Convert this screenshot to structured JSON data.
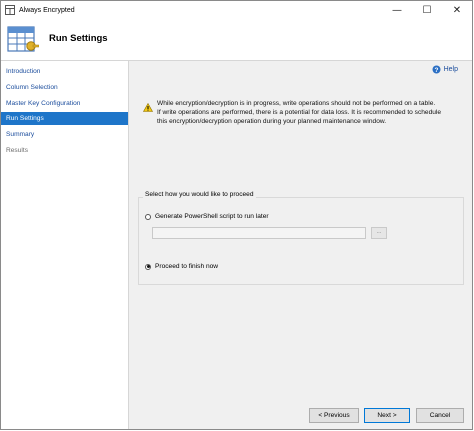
{
  "window": {
    "title": "Always Encrypted",
    "controls": {
      "minimize": "—",
      "maximize": "☐",
      "close": "✕"
    }
  },
  "header": {
    "title": "Run Settings"
  },
  "sidebar": {
    "items": [
      {
        "label": "Introduction",
        "state": "link"
      },
      {
        "label": "Column Selection",
        "state": "link"
      },
      {
        "label": "Master Key Configuration",
        "state": "link"
      },
      {
        "label": "Run Settings",
        "state": "selected"
      },
      {
        "label": "Summary",
        "state": "link"
      },
      {
        "label": "Results",
        "state": "disabled"
      }
    ]
  },
  "help": {
    "label": "Help"
  },
  "warning": {
    "icon": "warning-icon",
    "lines": [
      "While encryption/decryption is in progress, write operations should not be performed on a table.",
      "If write operations are performed, there is a potential for data loss. It is recommended to schedule",
      "this encryption/decryption operation during your planned maintenance window."
    ]
  },
  "proceed": {
    "legend": "Select how you would like to proceed",
    "option_script": "Generate PowerShell script to run later",
    "script_path_value": "",
    "browse_label": "...",
    "option_finish": "Proceed to finish now",
    "selected": "finish"
  },
  "footer": {
    "previous": "< Previous",
    "next": "Next >",
    "cancel": "Cancel"
  },
  "colors": {
    "selection": "#1e75c9",
    "link": "#1a4c9c",
    "warning": "#f2c811"
  }
}
